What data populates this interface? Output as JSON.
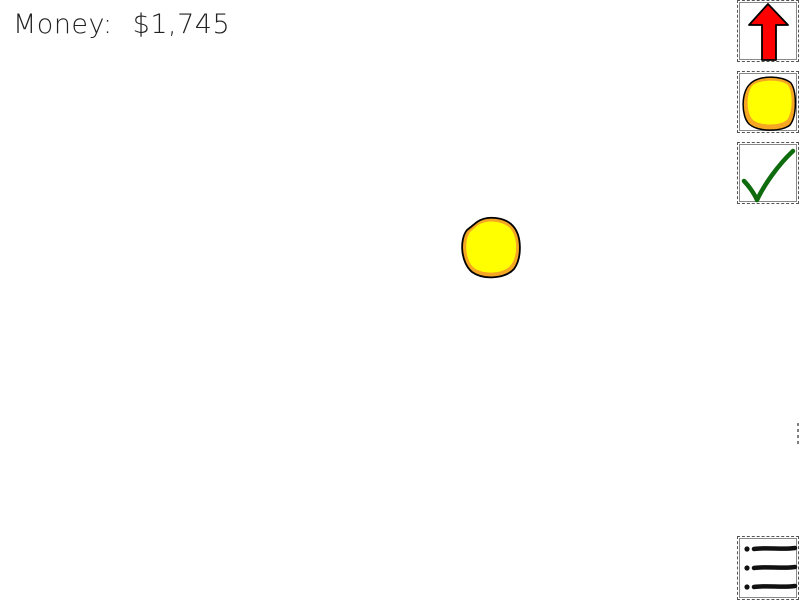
{
  "hud": {
    "money_label": "Money:",
    "money_value": "$1,745"
  },
  "toolbar": {
    "upgrade": {
      "icon": "red-up-arrow-icon",
      "color": "#ff0000"
    },
    "coin": {
      "icon": "coin-icon",
      "color": "#ffff00",
      "rim": "#f5a623"
    },
    "confirm": {
      "icon": "green-checkmark-icon",
      "color": "#0e6b0e"
    },
    "menu": {
      "icon": "menu-list-icon"
    }
  },
  "playfield": {
    "coin_color": "#ffff00"
  }
}
